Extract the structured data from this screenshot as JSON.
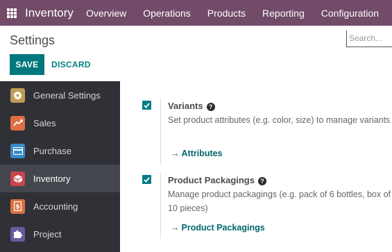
{
  "navbar": {
    "app_title": "Inventory",
    "items": [
      "Overview",
      "Operations",
      "Products",
      "Reporting",
      "Configuration"
    ],
    "color": "#714b67"
  },
  "control_panel": {
    "title": "Settings",
    "search_placeholder": "Search...",
    "save_label": "SAVE",
    "discard_label": "DISCARD"
  },
  "sidebar": {
    "items": [
      {
        "label": "General Settings",
        "icon": "gear-icon",
        "color": "#c09b56"
      },
      {
        "label": "Sales",
        "icon": "chart-line-icon",
        "color": "#e06d45"
      },
      {
        "label": "Purchase",
        "icon": "credit-card-icon",
        "color": "#3a8bc9"
      },
      {
        "label": "Inventory",
        "icon": "box-icon",
        "color": "#c9454a",
        "active": true
      },
      {
        "label": "Accounting",
        "icon": "invoice-icon",
        "color": "#dd6f41"
      },
      {
        "label": "Project",
        "icon": "puzzle-icon",
        "color": "#6c5b9e"
      }
    ]
  },
  "settings": [
    {
      "title": "Variants",
      "checked": true,
      "description": "Set product attributes (e.g. color, size) to manage variants",
      "link": "Attributes"
    },
    {
      "title": "Product Packagings",
      "checked": true,
      "description": "Manage product packagings (e.g. pack of 6 bottles, box of 10 pieces)",
      "link": "Product Packagings"
    }
  ],
  "colors": {
    "primary": "#017e84",
    "sidebar_bg": "#2f3136",
    "sidebar_active": "#43464d"
  }
}
